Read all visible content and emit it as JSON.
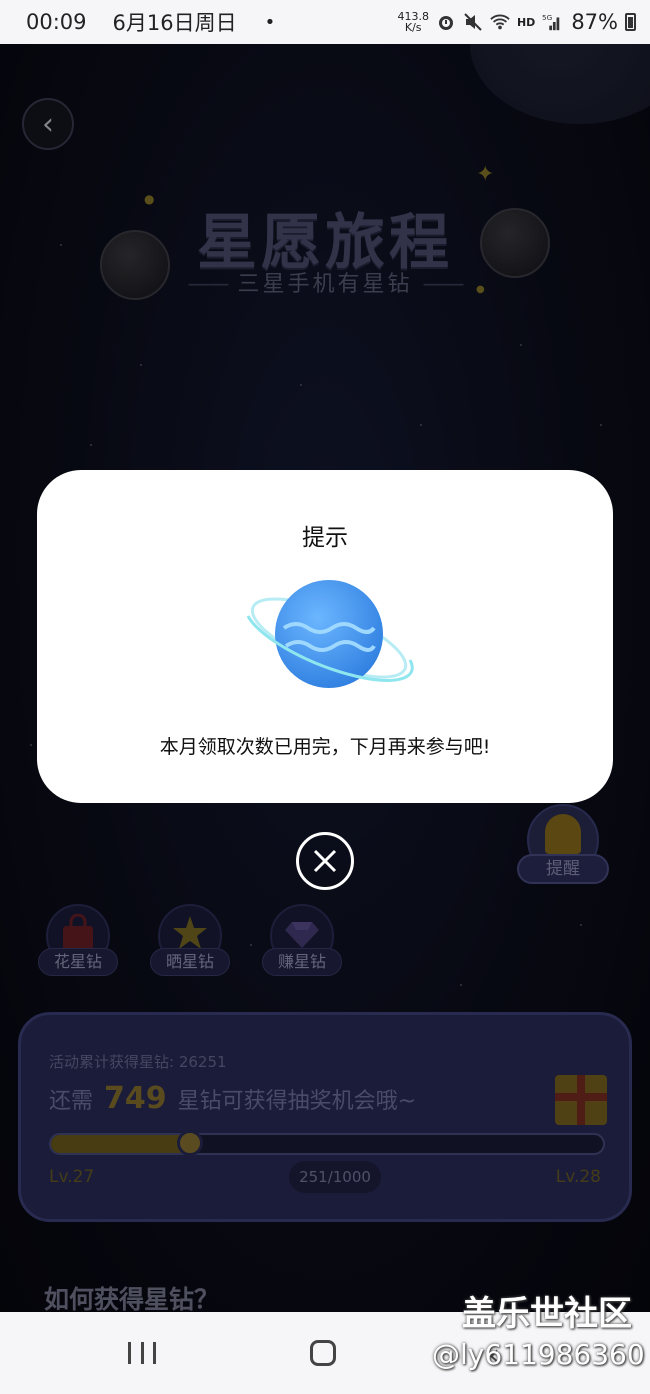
{
  "status_bar": {
    "time": "00:09",
    "date": "6月16日周日",
    "dot": "•",
    "net_speed_value": "413.8",
    "net_speed_unit": "K/s",
    "hd": "HD",
    "signal_type": "5G",
    "battery": "87%"
  },
  "header": {
    "title": "星愿旅程",
    "subtitle": "三星手机有星钻"
  },
  "reminder": {
    "label": "提醒"
  },
  "actions": [
    {
      "label": "花星钻",
      "icon": "shopping-bag-icon"
    },
    {
      "label": "晒星钻",
      "icon": "star-icon"
    },
    {
      "label": "赚星钻",
      "icon": "diamond-icon"
    }
  ],
  "progress": {
    "stat_label": "活动累计获得星钻: 26251",
    "need_prefix": "还需",
    "need_value": "749",
    "need_suffix": "星钻可获得抽奖机会哦~",
    "current": 251,
    "total": 1000,
    "counter_text": "251/1000",
    "level_current": "Lv.27",
    "level_next": "Lv.28"
  },
  "section": {
    "how_title": "如何获得星钻？"
  },
  "modal": {
    "title": "提示",
    "message": "本月领取次数已用完，下月再来参与吧!"
  },
  "watermark": {
    "line1": "盖乐世社区",
    "line2": "@ly611986360"
  },
  "colors": {
    "accent_gold": "#8a7430",
    "card_bg": "#2a2c58",
    "planet_blue": "#3d8ee8"
  }
}
